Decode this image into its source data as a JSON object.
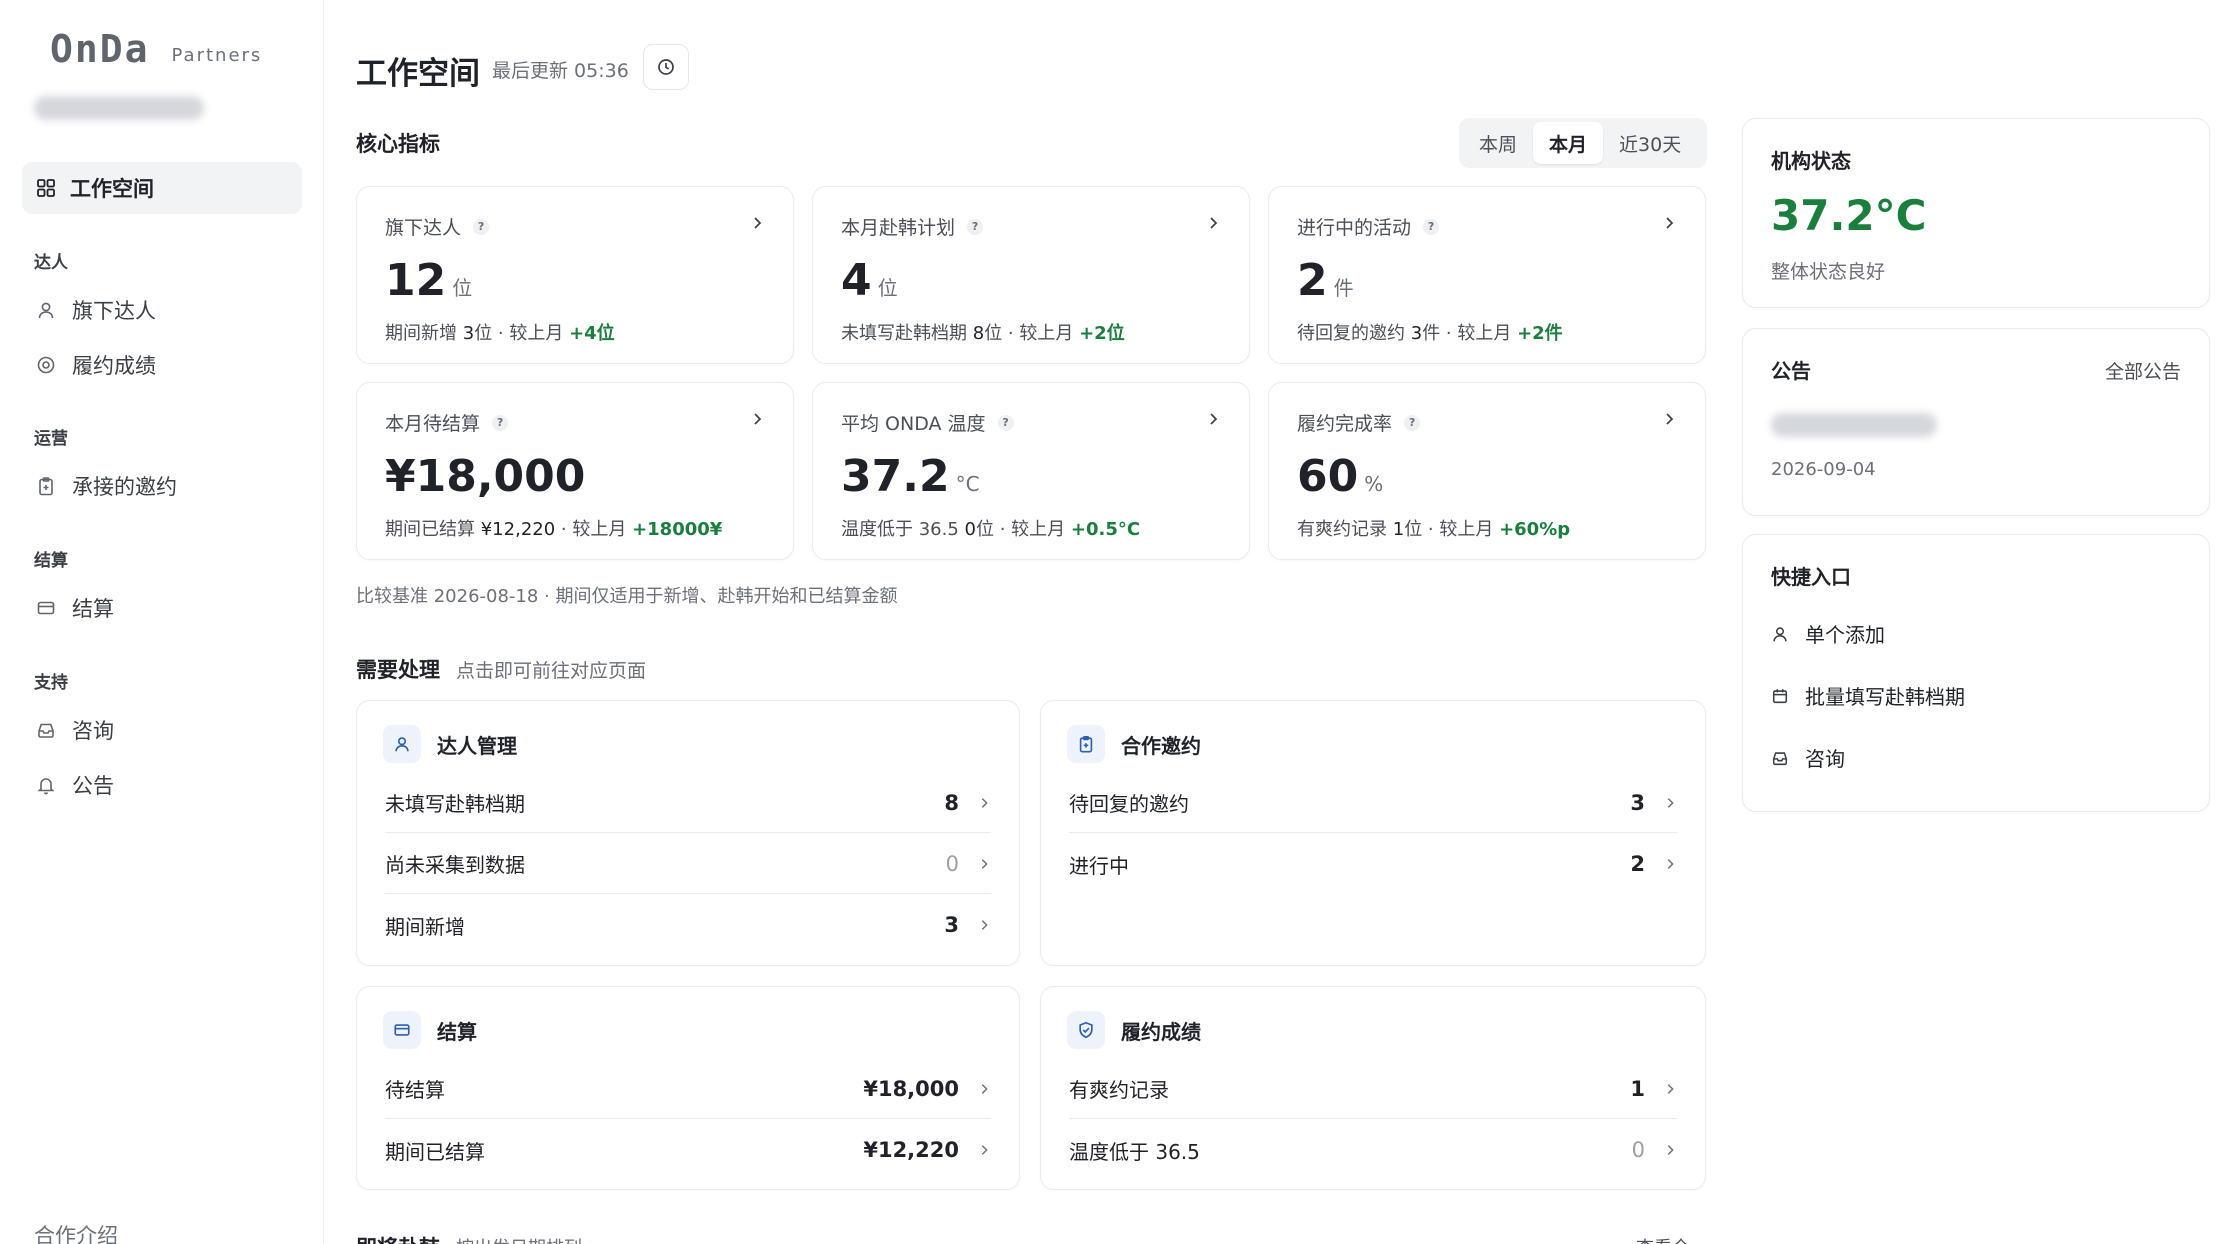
{
  "app": {
    "logo_text": "OnDa",
    "logo_sub": "Partners"
  },
  "sidebar": {
    "active": {
      "label": "工作空间",
      "icon": "grid-icon"
    },
    "groups": [
      {
        "title": "达人",
        "items": [
          {
            "label": "旗下达人",
            "icon": "user-icon"
          },
          {
            "label": "履约成绩",
            "icon": "target-icon"
          }
        ]
      },
      {
        "title": "运营",
        "items": [
          {
            "label": "承接的邀约",
            "icon": "clipboard-icon"
          }
        ]
      },
      {
        "title": "结算",
        "items": [
          {
            "label": "结算",
            "icon": "card-icon"
          }
        ]
      },
      {
        "title": "支持",
        "items": [
          {
            "label": "咨询",
            "icon": "inbox-icon"
          },
          {
            "label": "公告",
            "icon": "bell-icon"
          }
        ]
      }
    ],
    "footer": "合作介绍"
  },
  "header": {
    "title": "工作空间",
    "last_updated": "最后更新 05:36"
  },
  "kpi_section": {
    "title": "核心指标",
    "tabs": [
      "本周",
      "本月",
      "近30天"
    ],
    "active_tab": "本月",
    "cards": [
      {
        "label": "旗下达人",
        "value": "12",
        "unit": "位",
        "foot_a": "期间新增 ",
        "foot_b": "3",
        "foot_c": "位 · 较上月 ",
        "delta": "+4位"
      },
      {
        "label": "本月赴韩计划",
        "value": "4",
        "unit": "位",
        "foot_a": "未填写赴韩档期 ",
        "foot_b": "8",
        "foot_c": "位 · 较上月 ",
        "delta": "+2位"
      },
      {
        "label": "进行中的活动",
        "value": "2",
        "unit": "件",
        "foot_a": "待回复的邀约 ",
        "foot_b": "3",
        "foot_c": "件 · 较上月 ",
        "delta": "+2件"
      },
      {
        "label": "本月待结算",
        "value": "¥18,000",
        "unit": "",
        "foot_a": "期间已结算 ",
        "foot_b": "¥12,220",
        "foot_c": " · 较上月 ",
        "delta": "+18000¥"
      },
      {
        "label": "平均 ONDA 温度",
        "value": "37.2",
        "unit": "°C",
        "foot_a": "温度低于 36.5 ",
        "foot_b": "0",
        "foot_c": "位 · 较上月 ",
        "delta": "+0.5°C"
      },
      {
        "label": "履约完成率",
        "value": "60",
        "unit": "%",
        "foot_a": "有爽约记录 ",
        "foot_b": "1",
        "foot_c": "位 · 较上月 ",
        "delta": "+60%p"
      }
    ],
    "note": "比较基准 2026-08-18 · 期间仅适用于新增、赴韩开始和已结算金额"
  },
  "todo_section": {
    "title": "需要处理",
    "subtitle": "点击即可前往对应页面",
    "panels": [
      {
        "title": "达人管理",
        "icon": "user-icon",
        "rows": [
          {
            "label": "未填写赴韩档期",
            "value": "8"
          },
          {
            "label": "尚未采集到数据",
            "value": "0"
          },
          {
            "label": "期间新增",
            "value": "3"
          }
        ]
      },
      {
        "title": "合作邀约",
        "icon": "clipboard-icon",
        "rows": [
          {
            "label": "待回复的邀约",
            "value": "3"
          },
          {
            "label": "进行中",
            "value": "2"
          }
        ]
      },
      {
        "title": "结算",
        "icon": "card-icon",
        "rows": [
          {
            "label": "待结算",
            "value": "¥18,000"
          },
          {
            "label": "期间已结算",
            "value": "¥12,220"
          }
        ]
      },
      {
        "title": "履约成绩",
        "icon": "shield-check-icon",
        "rows": [
          {
            "label": "有爽约记录",
            "value": "1"
          },
          {
            "label": "温度低于 36.5",
            "value": "0"
          }
        ]
      }
    ]
  },
  "bottom_peek": {
    "title": "即将赴韩",
    "subtitle": "按出发日期排列",
    "link": "查看全部"
  },
  "right": {
    "status": {
      "title": "机构状态",
      "temperature": "37.2°C",
      "subtitle": "整体状态良好"
    },
    "notice": {
      "title": "公告",
      "link": "全部公告",
      "date": "2026-09-04"
    },
    "quick": {
      "title": "快捷入口",
      "items": [
        {
          "label": "单个添加",
          "icon": "user-icon"
        },
        {
          "label": "批量填写赴韩档期",
          "icon": "calendar-icon"
        },
        {
          "label": "咨询",
          "icon": "inbox-icon"
        }
      ]
    }
  },
  "colors": {
    "positive": "#1a7f3c",
    "accent_blue": "#2b5fb4",
    "muted": "#6b7079"
  }
}
